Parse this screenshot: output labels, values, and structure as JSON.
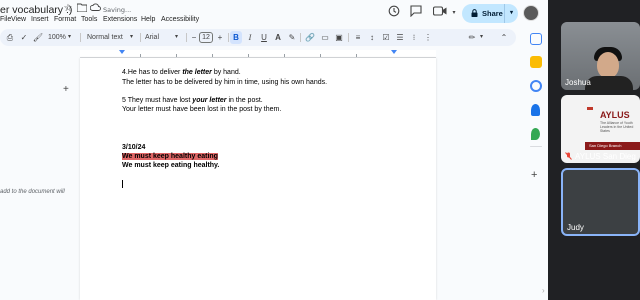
{
  "docs": {
    "title": "er vocabulary :)",
    "saving": "Saving...",
    "menu": [
      "File",
      "View",
      "Insert",
      "Format",
      "Tools",
      "Extensions",
      "Help",
      "Accessibility"
    ],
    "share_label": "Share",
    "toolbar": {
      "zoom": "100%",
      "style": "Normal text",
      "font": "Arial",
      "font_size": "12",
      "minus": "−",
      "plus": "+"
    },
    "outline_add": "+",
    "outline_hint": "add to the document will",
    "content": {
      "line1_prefix": "4.He has to deliver ",
      "line1_bold": "the letter",
      "line1_suffix": " by hand.",
      "line2": "The letter has to be delivered by him in time, using his own hands.",
      "line3_prefix": "5 They must have lost ",
      "line3_bold": "your letter",
      "line3_suffix": " in the post.",
      "line4": "Your letter must have been lost in the post by them.",
      "date": "3/10/24",
      "highlighted": "We must keep healthy eating",
      "corrected": "We must keep eating healthy."
    },
    "colors": {
      "highlight": "#e06666",
      "share_bg": "#c2e7ff",
      "toolbar_bg": "#edf2fa"
    }
  },
  "call": {
    "participants": [
      {
        "name": "Joshua"
      },
      {
        "name": "AYLUS San Dieg"
      },
      {
        "name": "Judy"
      }
    ],
    "slide": {
      "logo": "AYLUS",
      "sub": "The Alliance of Youth Leaders in the United States",
      "banner": "San Diego Branch"
    }
  }
}
